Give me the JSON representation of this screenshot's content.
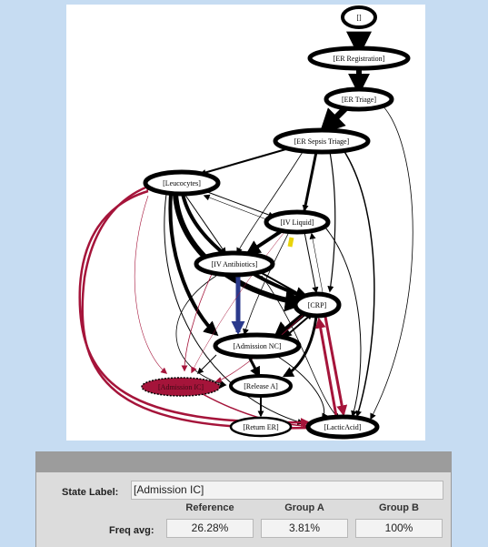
{
  "graph": {
    "nodes": [
      {
        "id": "n_start",
        "label": "[]",
        "selected": false
      },
      {
        "id": "n_erreg",
        "label": "[ER Registration]",
        "selected": false
      },
      {
        "id": "n_ertri",
        "label": "[ER Triage]",
        "selected": false
      },
      {
        "id": "n_ersep",
        "label": "[ER Sepsis Triage]",
        "selected": false
      },
      {
        "id": "n_leuco",
        "label": "[Leucocytes]",
        "selected": false
      },
      {
        "id": "n_ivliq",
        "label": "[IV Liquid]",
        "selected": false
      },
      {
        "id": "n_ivant",
        "label": "[IV Antibiotics]",
        "selected": false
      },
      {
        "id": "n_crp",
        "label": "[CRP]",
        "selected": false
      },
      {
        "id": "n_admnc",
        "label": "[Admission NC]",
        "selected": false
      },
      {
        "id": "n_admic",
        "label": "[Admission IC]",
        "selected": true
      },
      {
        "id": "n_rela",
        "label": "[Release A]",
        "selected": false
      },
      {
        "id": "n_reter",
        "label": "[Return ER]",
        "selected": false
      },
      {
        "id": "n_lact",
        "label": "[LacticAcid]",
        "selected": false
      }
    ],
    "colors": {
      "edge": "#000000",
      "highlight": "#a5143a",
      "blue": "#2b3a8c",
      "yellow": "#e9d40a",
      "selected_fill": "#a5143a"
    }
  },
  "state_panel": {
    "state_label_caption": "State Label:",
    "state_label_value": "[Admission IC]",
    "columns": [
      "Reference",
      "Group A",
      "Group B"
    ],
    "freq_caption": "Freq avg:",
    "freq_values": [
      "26.28%",
      "3.81%",
      "100%"
    ]
  }
}
